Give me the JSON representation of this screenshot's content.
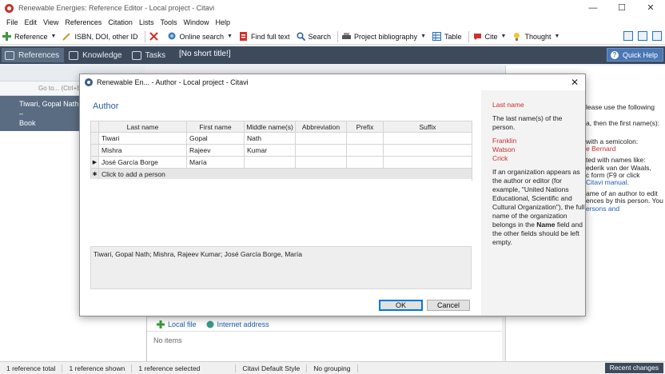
{
  "window": {
    "title": "Renewable Energies: Reference Editor - Local project - Citavi",
    "controls": [
      "—",
      "☐",
      "✕"
    ]
  },
  "menu": [
    "File",
    "Edit",
    "View",
    "References",
    "Citation",
    "Lists",
    "Tools",
    "Window",
    "Help"
  ],
  "toolbar": {
    "reference": "Reference",
    "isbn": "ISBN, DOI, other ID",
    "online_search": "Online search",
    "find_full_text": "Find full text",
    "search": "Search",
    "project_bibliography": "Project bibliography",
    "table": "Table",
    "cite": "Cite",
    "thought": "Thought"
  },
  "nav": {
    "tabs": [
      "References",
      "Knowledge",
      "Tasks"
    ],
    "short_title": "[No short title!]",
    "quick_help": "Quick Help"
  },
  "left_panel": {
    "search_placeholder": "Go to... (Ctrl+E",
    "selected_author": "Tiwari, Gopal Nath; Mi",
    "selected_dash": "–",
    "selected_type": "Book"
  },
  "links": {
    "local_file": "Local file",
    "internet_address": "Internet address",
    "no_items": "No items"
  },
  "right_pane": {
    "lines": [
      "lease use the following",
      "",
      "a, then the first name(s):",
      "",
      "",
      "with a semicolon:",
      "e Bernard",
      "",
      "ted with names like:",
      "ederik van der Waals,",
      "c form (F9 or click",
      "Citavi manual.",
      "",
      "ame of an author to edit",
      "ences by this person. You",
      "ersons and"
    ]
  },
  "status": {
    "total": "1 reference total",
    "shown": "1 reference shown",
    "selected": "1 reference selected",
    "style": "Citavi Default Style",
    "grouping": "No grouping",
    "recent": "Recent changes"
  },
  "dialog": {
    "title": "Renewable En... - Author - Local project - Citavi",
    "heading": "Author",
    "columns": [
      "Last name",
      "First name",
      "Middle name(s)",
      "Abbreviation",
      "Prefix",
      "Suffix"
    ],
    "rows": [
      {
        "last": "Tiwari",
        "first": "Gopal",
        "middle": "Nath",
        "abbr": "",
        "prefix": "",
        "suffix": ""
      },
      {
        "last": "Mishra",
        "first": "Rajeev",
        "middle": "Kumar",
        "abbr": "",
        "prefix": "",
        "suffix": ""
      },
      {
        "last": "José García Borge",
        "first": "María",
        "middle": "",
        "abbr": "",
        "prefix": "",
        "suffix": ""
      }
    ],
    "add_row": "Click to add a person",
    "summary": "Tiwari, Gopal Nath; Mishra, Rajeev Kumar; José García Borge, María",
    "ok": "OK",
    "cancel": "Cancel",
    "help": {
      "title": "Last name",
      "intro": "The last name(s) of the person.",
      "examples": [
        "Franklin",
        "Watson",
        "Crick"
      ],
      "body_1": "If an organization appears as the author or editor (for example, \"United Nations Educational, Scientific and Cultural Organization\"), the full name of the organization belongs in the ",
      "body_bold": "Name",
      "body_2": " field and the other fields should be left empty."
    }
  }
}
